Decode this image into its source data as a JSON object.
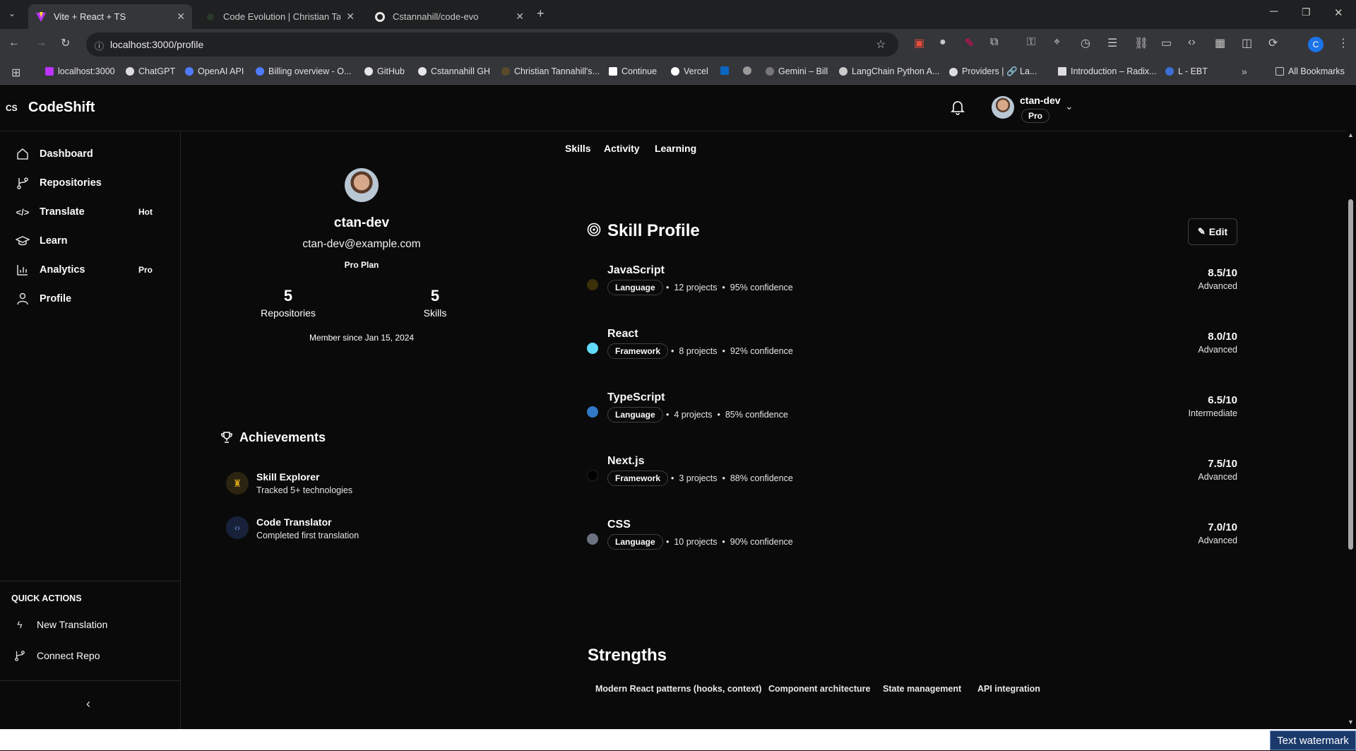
{
  "browser": {
    "tabs": [
      {
        "title": "Vite + React + TS",
        "active": true
      },
      {
        "title": "Code Evolution | Christian Tann",
        "active": false
      },
      {
        "title": "Cstannahill/code-evo",
        "active": false
      }
    ],
    "url": "localhost:3000/profile",
    "bookmarks": [
      "localhost:3000",
      "ChatGPT",
      "OpenAI API",
      "Billing overview - O...",
      "GitHub",
      "Cstannahill GH",
      "Christian Tannahill's...",
      "Continue",
      "Vercel",
      "Gemini – Bill",
      "LangChain Python A...",
      "Providers | 🔗 La...",
      "Introduction – Radix...",
      "L - EBT"
    ],
    "all_bookmarks": "All Bookmarks",
    "profile_initial": "C"
  },
  "app": {
    "logo_mark": "CS",
    "name": "CodeShift",
    "user": {
      "name": "ctan-dev",
      "plan_badge": "Pro"
    }
  },
  "sidebar": {
    "items": [
      {
        "label": "Dashboard",
        "badge": ""
      },
      {
        "label": "Repositories",
        "badge": ""
      },
      {
        "label": "Translate",
        "badge": "Hot"
      },
      {
        "label": "Learn",
        "badge": ""
      },
      {
        "label": "Analytics",
        "badge": "Pro"
      },
      {
        "label": "Profile",
        "badge": ""
      }
    ],
    "quick_actions_heading": "QUICK ACTIONS",
    "quick_actions": [
      "New Translation",
      "Connect Repo"
    ]
  },
  "profile": {
    "tabs": [
      "Skills",
      "Activity",
      "Learning"
    ],
    "username": "ctan-dev",
    "email": "ctan-dev@example.com",
    "plan": "Pro Plan",
    "stats": [
      {
        "value": "5",
        "label": "Repositories"
      },
      {
        "value": "5",
        "label": "Skills"
      }
    ],
    "member_since": "Member since Jan 15, 2024"
  },
  "achievements": {
    "title": "Achievements",
    "items": [
      {
        "title": "Skill Explorer",
        "desc": "Tracked 5+ technologies"
      },
      {
        "title": "Code Translator",
        "desc": "Completed first translation"
      }
    ]
  },
  "skill_profile": {
    "title": "Skill Profile",
    "edit_label": "Edit",
    "skills": [
      {
        "name": "JavaScript",
        "tag": "Language",
        "projects": "12 projects",
        "confidence": "95% confidence",
        "score": "8.5/10",
        "level": "Advanced",
        "color": "#3b2f0a"
      },
      {
        "name": "React",
        "tag": "Framework",
        "projects": "8 projects",
        "confidence": "92% confidence",
        "score": "8.0/10",
        "level": "Advanced",
        "color": "#61dafb"
      },
      {
        "name": "TypeScript",
        "tag": "Language",
        "projects": "4 projects",
        "confidence": "85% confidence",
        "score": "6.5/10",
        "level": "Intermediate",
        "color": "#3178c6"
      },
      {
        "name": "Next.js",
        "tag": "Framework",
        "projects": "3 projects",
        "confidence": "88% confidence",
        "score": "7.5/10",
        "level": "Advanced",
        "color": "#000000"
      },
      {
        "name": "CSS",
        "tag": "Language",
        "projects": "10 projects",
        "confidence": "90% confidence",
        "score": "7.0/10",
        "level": "Advanced",
        "color": "#6b7280"
      }
    ]
  },
  "strengths": {
    "title": "Strengths",
    "items": [
      "Modern React patterns (hooks, context)",
      "Component architecture",
      "State management",
      "API integration"
    ]
  },
  "watermark": "Text watermark"
}
